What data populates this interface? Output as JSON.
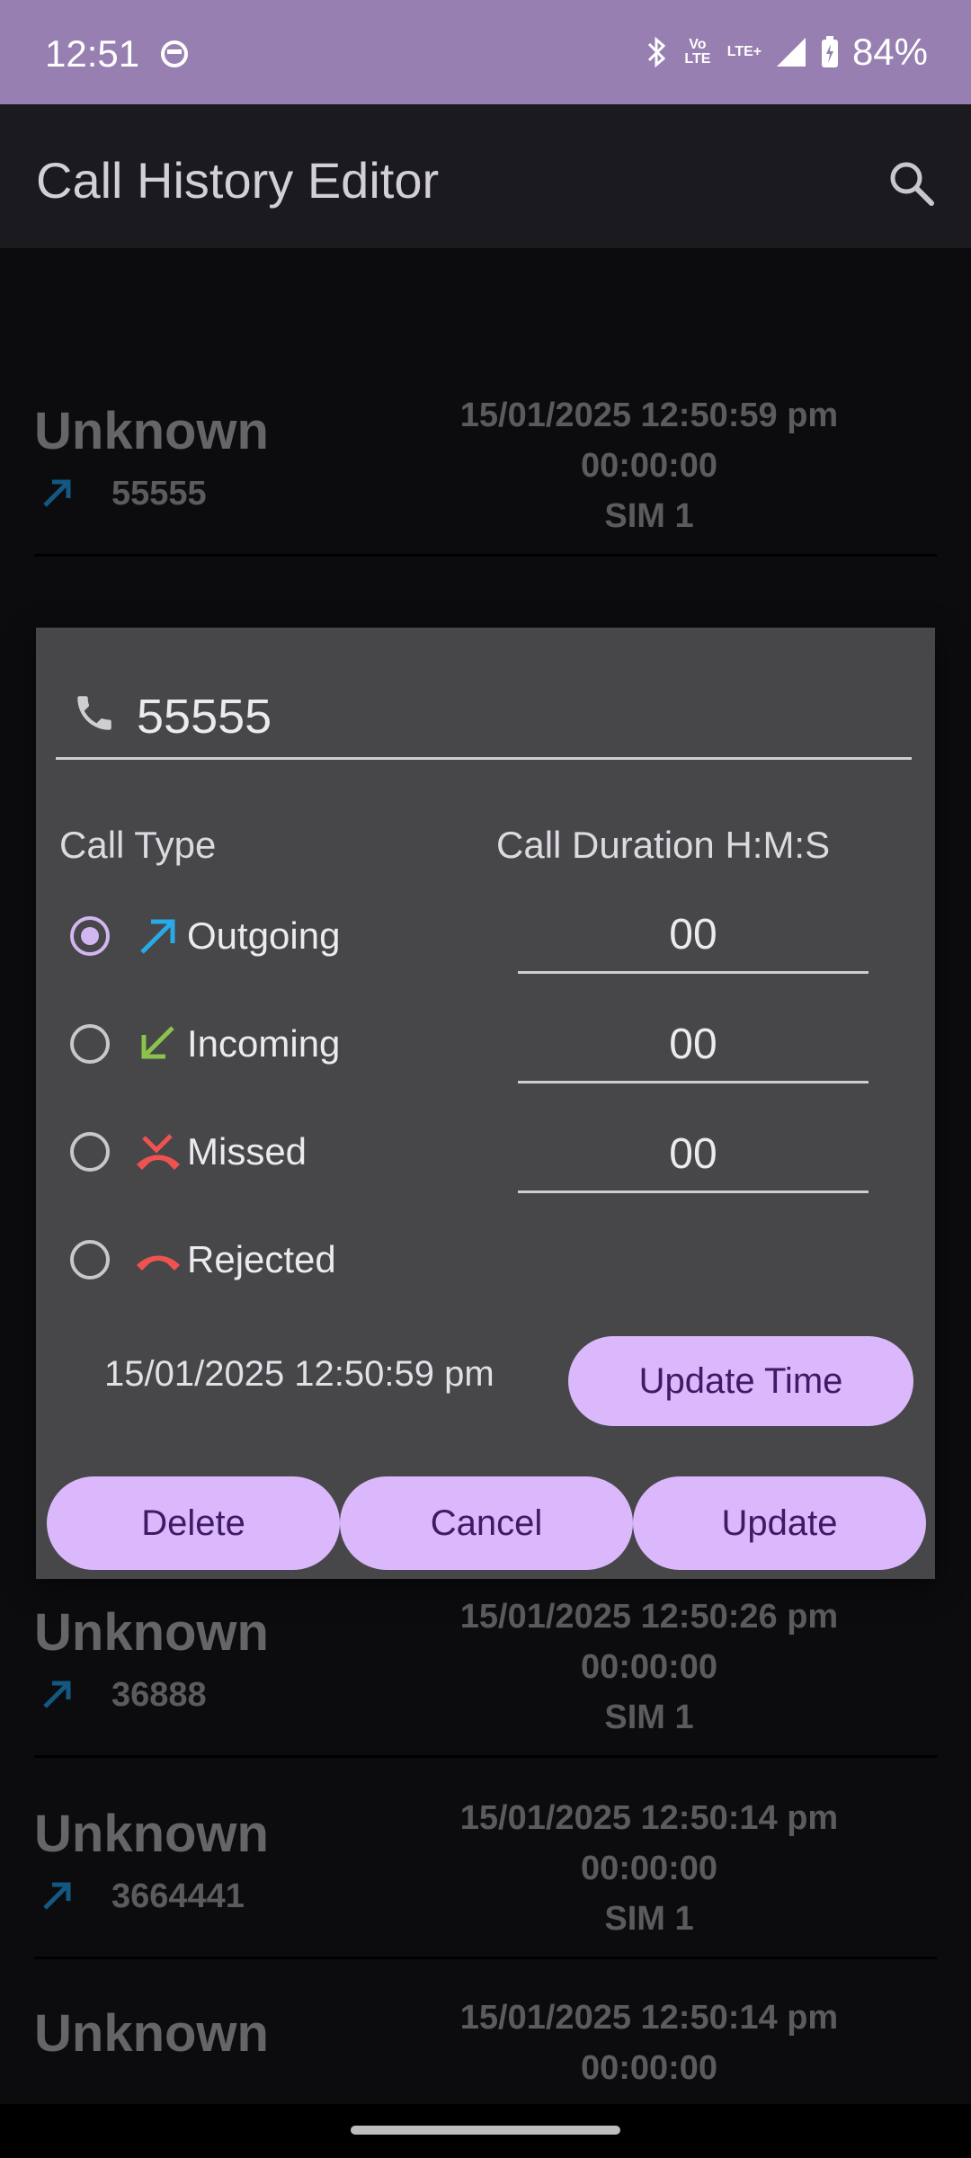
{
  "status_bar": {
    "time": "12:51",
    "battery": "84%",
    "volte": "Vo LTE",
    "lte": "LTE+"
  },
  "app_bar": {
    "title": "Call History Editor",
    "search_icon": "search-icon"
  },
  "list": [
    {
      "name": "Unknown",
      "number": "55555",
      "datetime": "15/01/2025 12:50:59 pm",
      "duration": "00:00:00",
      "sim": "SIM 1"
    },
    {
      "name": "Unknown",
      "number": "36888",
      "datetime": "15/01/2025 12:50:26 pm",
      "duration": "00:00:00",
      "sim": "SIM 1"
    },
    {
      "name": "Unknown",
      "number": "3664441",
      "datetime": "15/01/2025 12:50:14 pm",
      "duration": "00:00:00",
      "sim": "SIM 1"
    },
    {
      "name": "Unknown",
      "number": "",
      "datetime": "15/01/2025 12:50:14 pm",
      "duration": "00:00:00",
      "sim": ""
    }
  ],
  "dialog": {
    "phone_value": "55555",
    "call_type_label": "Call Type",
    "call_duration_label": "Call Duration H:M:S",
    "call_types": [
      {
        "label": "Outgoing",
        "selected": true,
        "icon": "outgoing-arrow-icon",
        "color": "#29a9e5"
      },
      {
        "label": "Incoming",
        "selected": false,
        "icon": "incoming-arrow-icon",
        "color": "#8bc34a"
      },
      {
        "label": "Missed",
        "selected": false,
        "icon": "missed-call-icon",
        "color": "#ef5350"
      },
      {
        "label": "Rejected",
        "selected": false,
        "icon": "rejected-call-icon",
        "color": "#ef5350"
      }
    ],
    "duration": {
      "hours": "00",
      "minutes": "00",
      "seconds": "00"
    },
    "datetime": "15/01/2025 12:50:59 pm",
    "buttons": {
      "update_time": "Update Time",
      "delete": "Delete",
      "cancel": "Cancel",
      "update": "Update"
    }
  },
  "colors": {
    "accent": "#dab8fb",
    "statusbar": "#987fb1",
    "dialog": "#474649"
  }
}
